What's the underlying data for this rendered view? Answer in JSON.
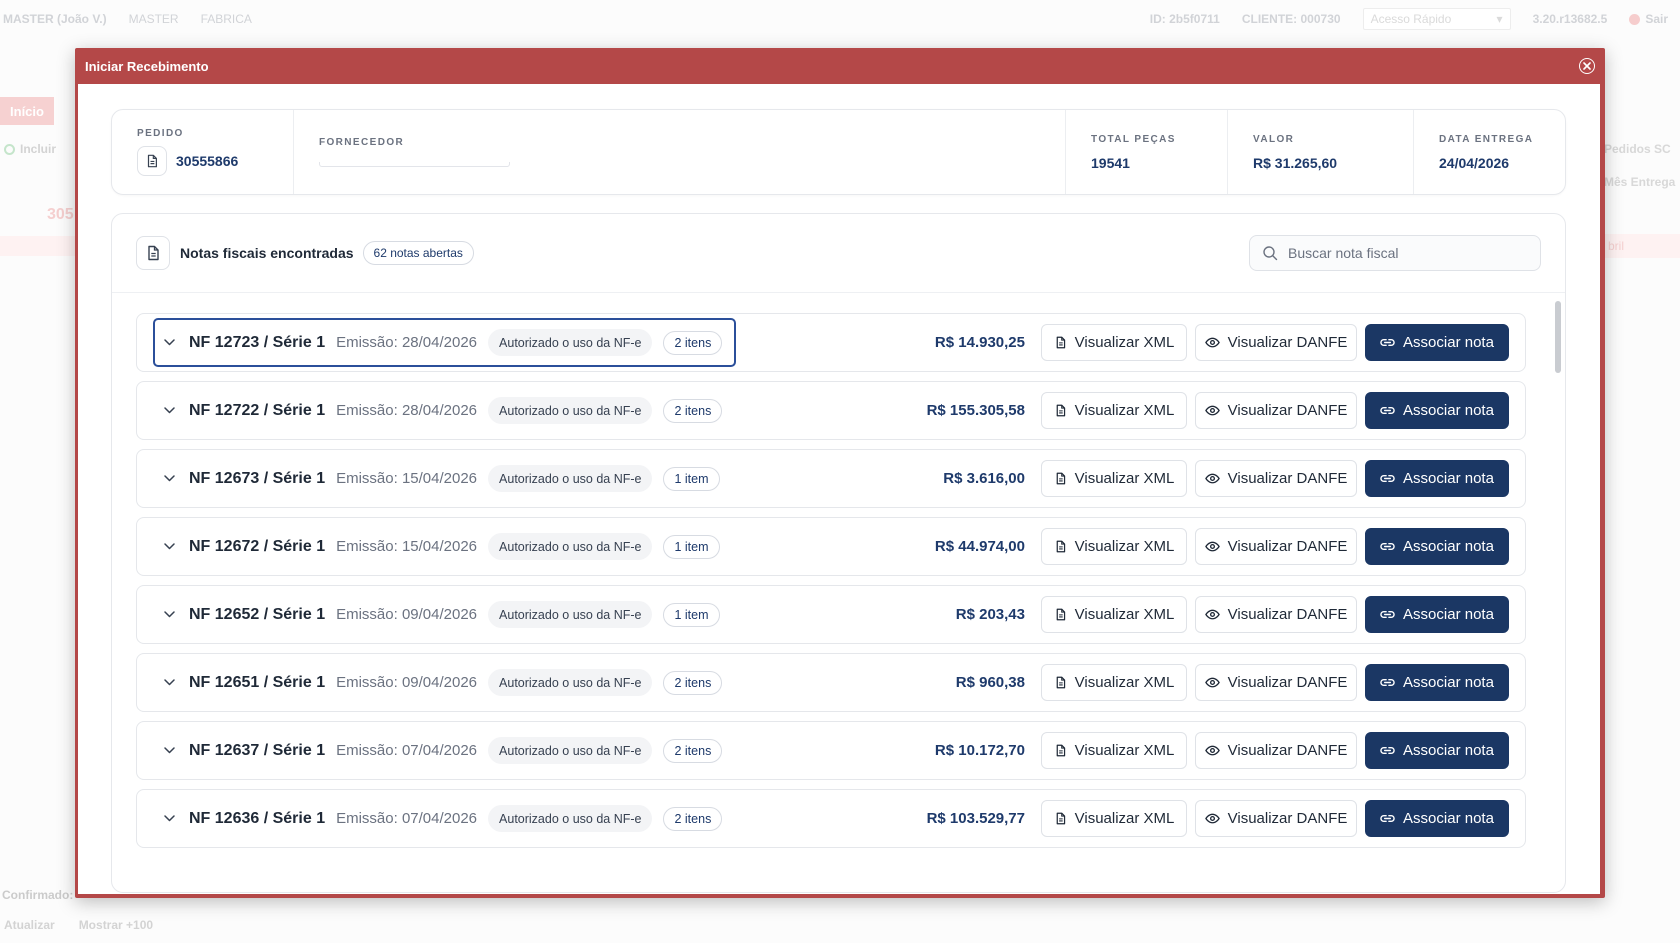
{
  "background": {
    "topbar_left": [
      "MASTER (João V.)",
      "MASTER",
      "FABRICA"
    ],
    "topbar_id": "ID: 2b5f0711",
    "topbar_cliente": "CLIENTE: 000730",
    "quick_access_placeholder": "Acesso Rápido",
    "version": "3.20.r13682.5",
    "sair": "Sair",
    "tab_inicio": "Início",
    "incluir": "Incluir",
    "partial_305": "305",
    "right_pedidos": "Pedidos SC",
    "right_mes": "Mês Entrega",
    "right_abril": "bril",
    "confirmado": "Confirmado:",
    "atualizar": "Atualizar",
    "mostrar": "Mostrar +100"
  },
  "modal": {
    "title": "Iniciar Recebimento",
    "summary": {
      "pedido_label": "PEDIDO",
      "pedido_value": "30555866",
      "fornecedor_label": "FORNECEDOR",
      "total_label": "TOTAL PEÇAS",
      "total_value": "19541",
      "valor_label": "VALOR",
      "valor_value": "R$ 31.265,60",
      "data_label": "DATA ENTREGA",
      "data_value": "24/04/2026"
    },
    "notes": {
      "title": "Notas fiscais encontradas",
      "badge": "62 notas abertas",
      "search_placeholder": "Buscar nota fiscal",
      "xml_label": "Visualizar XML",
      "danfe_label": "Visualizar DANFE",
      "associar_label": "Associar nota",
      "rows": [
        {
          "nf": "NF 12723 / Série 1",
          "emissao": "Emissão: 28/04/2026",
          "status": "Autorizado o uso da NF-e",
          "itens": "2 itens",
          "valor": "R$ 14.930,25"
        },
        {
          "nf": "NF 12722 / Série 1",
          "emissao": "Emissão: 28/04/2026",
          "status": "Autorizado o uso da NF-e",
          "itens": "2 itens",
          "valor": "R$ 155.305,58"
        },
        {
          "nf": "NF 12673 / Série 1",
          "emissao": "Emissão: 15/04/2026",
          "status": "Autorizado o uso da NF-e",
          "itens": "1 item",
          "valor": "R$ 3.616,00"
        },
        {
          "nf": "NF 12672 / Série 1",
          "emissao": "Emissão: 15/04/2026",
          "status": "Autorizado o uso da NF-e",
          "itens": "1 item",
          "valor": "R$ 44.974,00"
        },
        {
          "nf": "NF 12652 / Série 1",
          "emissao": "Emissão: 09/04/2026",
          "status": "Autorizado o uso da NF-e",
          "itens": "1 item",
          "valor": "R$ 203,43"
        },
        {
          "nf": "NF 12651 / Série 1",
          "emissao": "Emissão: 09/04/2026",
          "status": "Autorizado o uso da NF-e",
          "itens": "2 itens",
          "valor": "R$ 960,38"
        },
        {
          "nf": "NF 12637 / Série 1",
          "emissao": "Emissão: 07/04/2026",
          "status": "Autorizado o uso da NF-e",
          "itens": "2 itens",
          "valor": "R$ 10.172,70"
        },
        {
          "nf": "NF 12636 / Série 1",
          "emissao": "Emissão: 07/04/2026",
          "status": "Autorizado o uso da NF-e",
          "itens": "2 itens",
          "valor": "R$ 103.529,77"
        }
      ]
    }
  }
}
